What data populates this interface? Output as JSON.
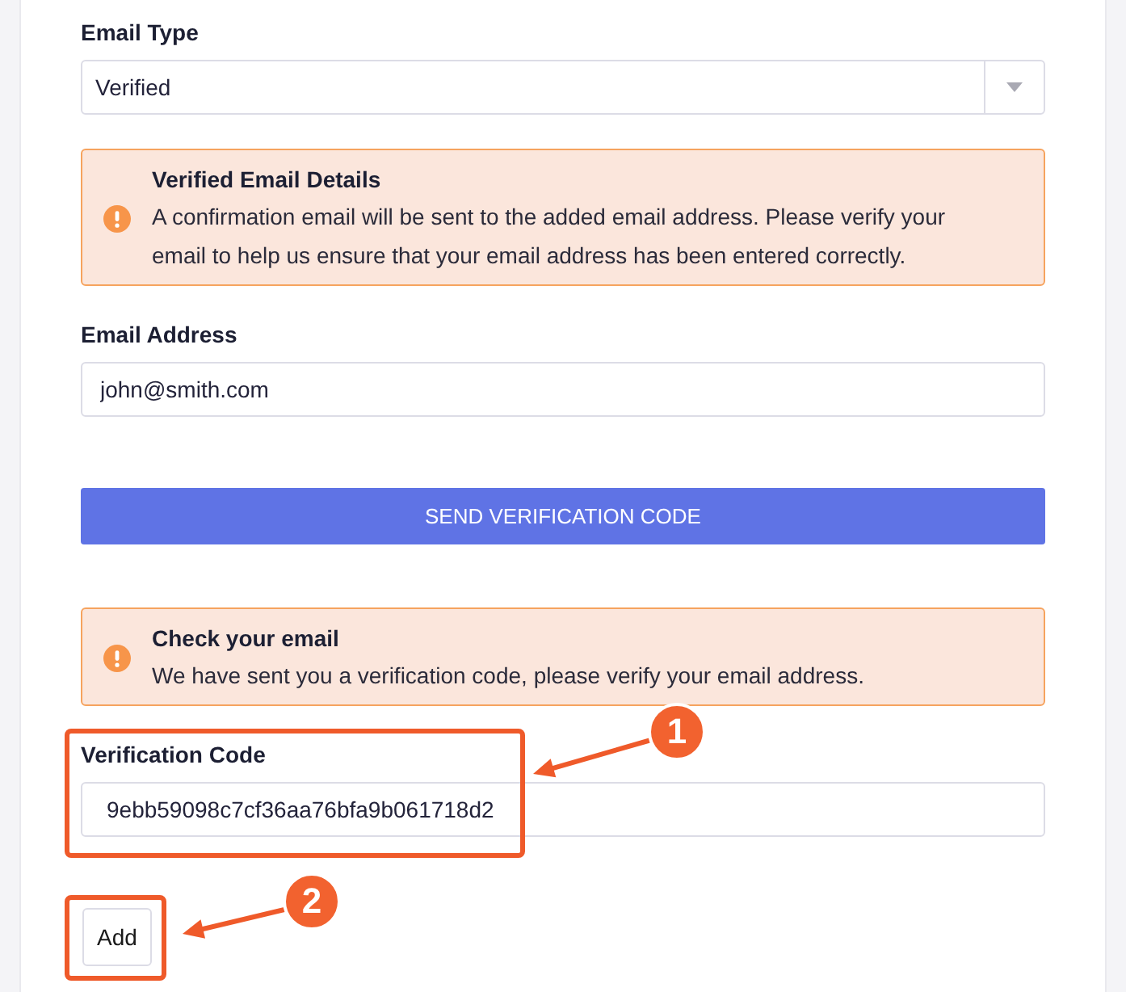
{
  "form": {
    "items": [
      {
        "kind": "select",
        "label": "Email Type",
        "value": "Verified"
      },
      {
        "kind": "alert",
        "title": "Verified Email Details",
        "text": "A confirmation email will be sent to the added email address. Please verify your email to help us ensure that your email address has been entered correctly."
      },
      {
        "kind": "input",
        "label": "Email Address",
        "value": "john@smith.com"
      },
      {
        "kind": "button",
        "label": "SEND VERIFICATION CODE"
      },
      {
        "kind": "alert",
        "title": "Check your email",
        "text": "We have sent you a verification code, please verify your email address."
      },
      {
        "kind": "input",
        "label": "Verification Code",
        "value": "9ebb59098c7cf36aa76bfa9b061718d2",
        "callout": "1"
      },
      {
        "kind": "small_button",
        "label": "Add",
        "callout": "2"
      }
    ]
  }
}
